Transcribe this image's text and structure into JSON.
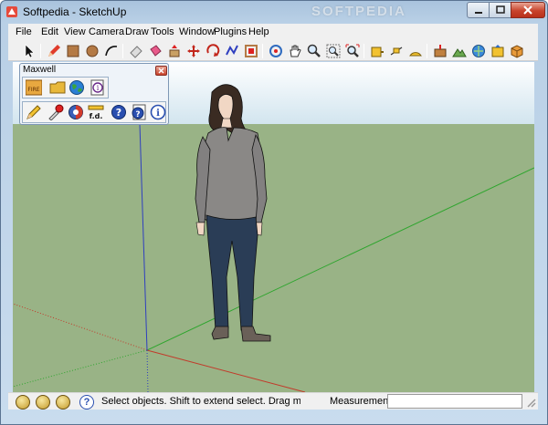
{
  "window": {
    "title": "Softpedia - SketchUp",
    "watermark": "SOFTPEDIA",
    "buttons": {
      "minimize": "minimize",
      "maximize": "maximize",
      "close": "close"
    }
  },
  "menu": [
    "File",
    "Edit",
    "View",
    "Camera",
    "Draw",
    "Tools",
    "Window",
    "Plugins",
    "Help"
  ],
  "toolbar": {
    "tools": [
      "select-arrow",
      "pencil-line",
      "rectangle",
      "circle",
      "arc",
      "eraser",
      "paint-bucket",
      "push-pull",
      "move",
      "rotate",
      "follow-me",
      "offset",
      "orbit",
      "pan",
      "zoom",
      "zoom-window",
      "zoom-extents",
      "tape-measure",
      "dimension",
      "protractor",
      "text",
      "axes",
      "3d-text",
      "add-location",
      "toggle-terrain",
      "get-models",
      "share-model",
      "component"
    ]
  },
  "maxwell": {
    "title": "Maxwell",
    "fire_label": "FIRE",
    "fd_label": "f.d.",
    "row1": [
      "fire",
      "open-folder",
      "globe",
      "info-document"
    ],
    "row2": [
      "pencil",
      "eyedropper",
      "material-sphere",
      "focus-distance",
      "help",
      "help-document",
      "info"
    ]
  },
  "scene": {
    "sky_top": "#ffffff",
    "sky_bottom": "#d2e5ef",
    "ground": "#99b386",
    "figure": "woman standing, gray sweater, dark jeans"
  },
  "statusbar": {
    "icons": [
      "geo-location",
      "credits",
      "user-account",
      "help"
    ],
    "message": "Select objects. Shift to extend select. Drag mouse to s",
    "measurements_label": "Measurements",
    "measurements_value": ""
  },
  "colors": {
    "axis_red": "#c23a2a",
    "axis_green": "#2ea52e",
    "axis_blue": "#2f3fbf",
    "close_button": "#c8432c"
  }
}
